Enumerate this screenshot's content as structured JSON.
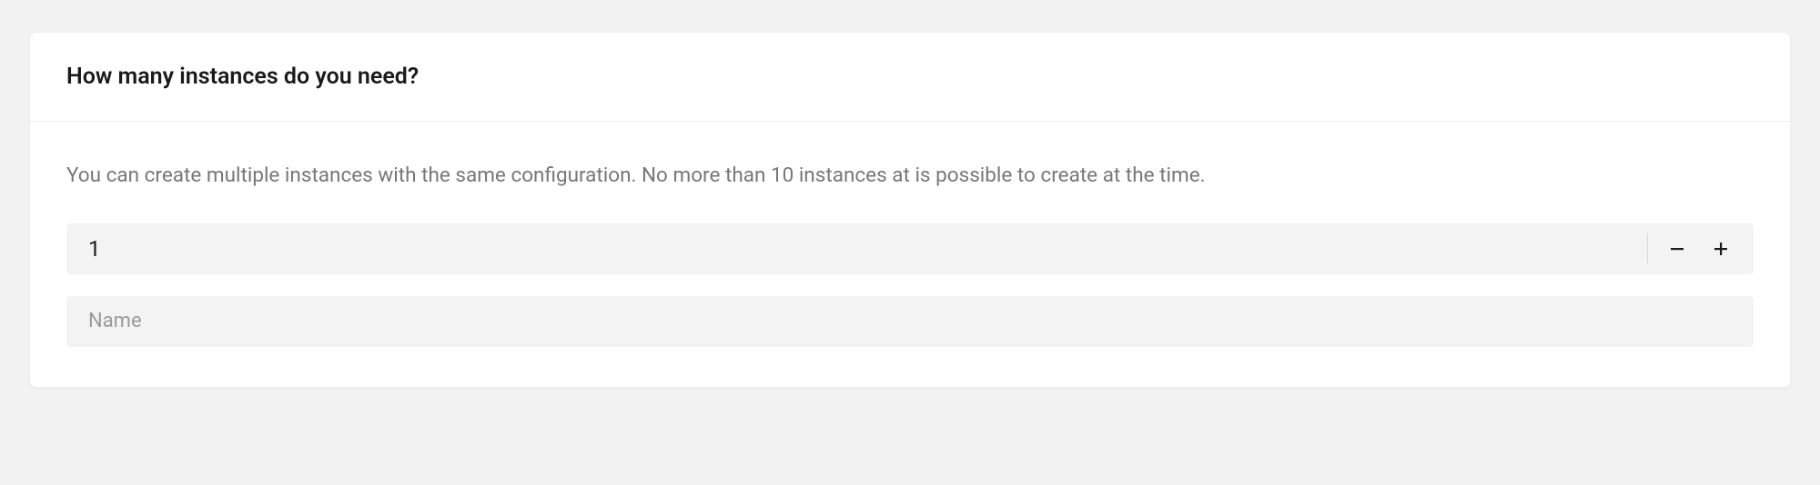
{
  "instances_section": {
    "title": "How many instances do you need?",
    "description": "You can create multiple instances with the same configuration. No more than 10 instances at is possible to create at the time.",
    "count_value": "1",
    "name_placeholder": "Name",
    "name_value": ""
  }
}
